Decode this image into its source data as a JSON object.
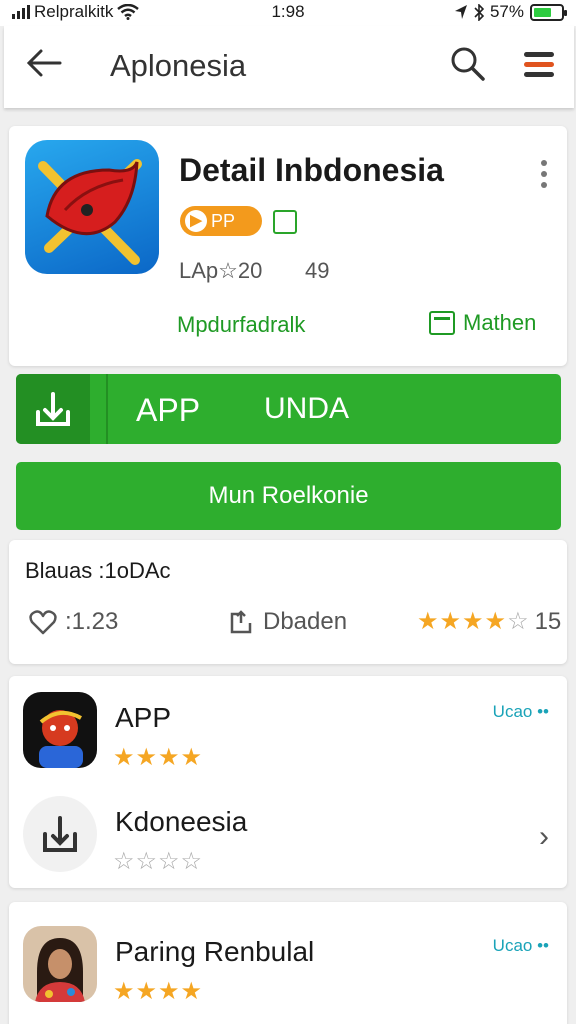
{
  "status": {
    "carrier": "Relpralkitk",
    "time": "1:98",
    "battery": "57%",
    "battery_level": 0.57
  },
  "appbar": {
    "title": "Aplonesia"
  },
  "app": {
    "name": "Detail Inbdonesia",
    "badge": "PP",
    "rating_label": "LAp☆20",
    "count": "49",
    "developer": "Mpdurfadralk",
    "more_label": "Mathen"
  },
  "install": {
    "label1": "APP",
    "label2": "UNDA"
  },
  "open_label": "Mun Roelkonie",
  "stats": {
    "label": "Blauas :1oDAc",
    "likes": ":1.23",
    "share": "Dbaden",
    "rating_count": "15",
    "rating_value": 3.5,
    "rating_max": 5
  },
  "list": [
    {
      "name": "APP",
      "tag": "Ucao",
      "stars": 3.5,
      "trailing": ""
    },
    {
      "name": "Kdoneesia",
      "tag": "",
      "stars": 0,
      "trailing": "›"
    }
  ],
  "list2": [
    {
      "name": "Paring Renbulal",
      "tag": "Ucao",
      "stars": 3.5
    }
  ],
  "colors": {
    "accent": "#2eae2e",
    "star": "#f5a623",
    "badge": "#f39a1c",
    "link": "#1f9a24"
  }
}
